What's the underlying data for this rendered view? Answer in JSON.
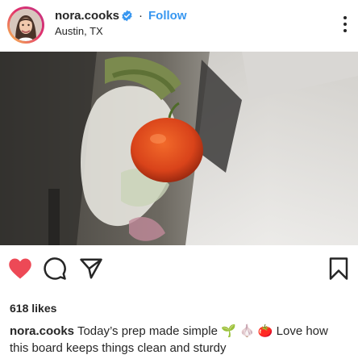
{
  "post": {
    "username": "nora.cooks",
    "separator": "·",
    "follow_label": "Follow",
    "location": "Austin, TX",
    "likes_text": "618 likes",
    "caption_user": "nora.cooks",
    "caption_text_1": "Today’s prep made simple ",
    "caption_emojis": "🌱 🧄 🍅",
    "caption_text_2": " Love how this board keeps things clean and sturdy"
  },
  "icons": {
    "verified": "verified-badge-icon",
    "more": "more-options-icon",
    "like": "heart-icon",
    "comment": "comment-icon",
    "share": "send-icon",
    "save": "bookmark-icon"
  },
  "colors": {
    "like_red": "#ed4956",
    "follow_blue": "#3897f0",
    "verified_blue": "#3897f0",
    "text": "#262626"
  },
  "state": {
    "liked": true
  }
}
